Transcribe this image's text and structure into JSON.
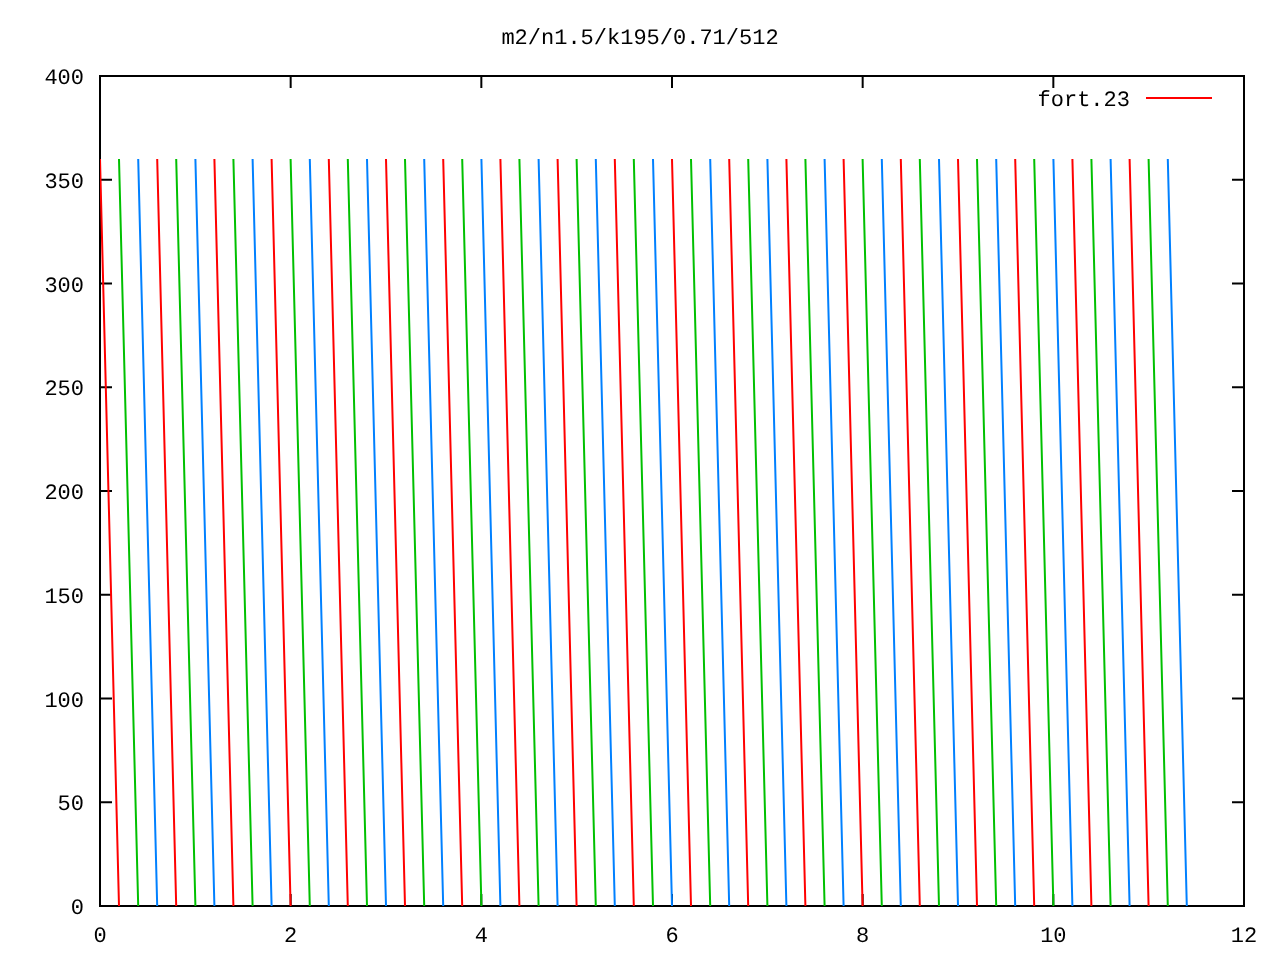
{
  "chart_data": {
    "type": "line",
    "title": "m2/n1.5/k195/0.71/512",
    "xlim": [
      0,
      12
    ],
    "ylim": [
      0,
      400
    ],
    "xticks": [
      0,
      2,
      4,
      6,
      8,
      10,
      12
    ],
    "yticks": [
      0,
      50,
      100,
      150,
      200,
      250,
      300,
      350,
      400
    ],
    "x": [
      0,
      0.2,
      0.4,
      0.6,
      0.8,
      1,
      1.2,
      1.4,
      1.6,
      1.8,
      2,
      2.2,
      2.4,
      2.6,
      2.8,
      3,
      3.2,
      3.4,
      3.6,
      3.8,
      4,
      4.2,
      4.4,
      4.6,
      4.8,
      5,
      5.2,
      5.4,
      5.6,
      5.8,
      6,
      6.2,
      6.4,
      6.6,
      6.8,
      7,
      7.2,
      7.4,
      7.6,
      7.8,
      8,
      8.2,
      8.4,
      8.6,
      8.8,
      9,
      9.2,
      9.4,
      9.6,
      9.8,
      10,
      10.2,
      10.4,
      10.6,
      10.8,
      11,
      11.2,
      11.4
    ],
    "series": [
      {
        "name": "fort.23",
        "color": "#ff0000",
        "values": [
          360,
          0,
          null,
          360,
          0,
          null,
          360,
          0,
          null,
          360,
          0,
          null,
          360,
          0,
          null,
          360,
          0,
          null,
          360,
          0,
          null,
          360,
          0,
          null,
          360,
          0,
          null,
          360,
          0,
          null,
          360,
          0,
          null,
          360,
          0,
          null,
          360,
          0,
          null,
          360,
          0,
          null,
          360,
          0,
          null,
          360,
          0,
          null,
          360,
          0,
          null,
          360,
          0,
          null,
          360,
          0,
          null,
          null
        ]
      },
      {
        "color": "#00c000",
        "values": [
          null,
          360,
          0,
          null,
          360,
          0,
          null,
          360,
          0,
          null,
          360,
          0,
          null,
          360,
          0,
          null,
          360,
          0,
          null,
          360,
          0,
          null,
          360,
          0,
          null,
          360,
          0,
          null,
          360,
          0,
          null,
          360,
          0,
          null,
          360,
          0,
          null,
          360,
          0,
          null,
          360,
          0,
          null,
          360,
          0,
          null,
          360,
          0,
          null,
          360,
          0,
          null,
          360,
          0,
          null,
          360,
          0,
          null
        ]
      },
      {
        "color": "#0080ff",
        "values": [
          null,
          null,
          360,
          0,
          null,
          360,
          0,
          null,
          360,
          0,
          null,
          360,
          0,
          null,
          360,
          0,
          null,
          360,
          0,
          null,
          360,
          0,
          null,
          360,
          0,
          null,
          360,
          0,
          null,
          360,
          0,
          null,
          360,
          0,
          null,
          360,
          0,
          null,
          360,
          0,
          null,
          360,
          0,
          null,
          360,
          0,
          null,
          360,
          0,
          null,
          360,
          0,
          null,
          360,
          0,
          null,
          360,
          0
        ]
      }
    ]
  }
}
